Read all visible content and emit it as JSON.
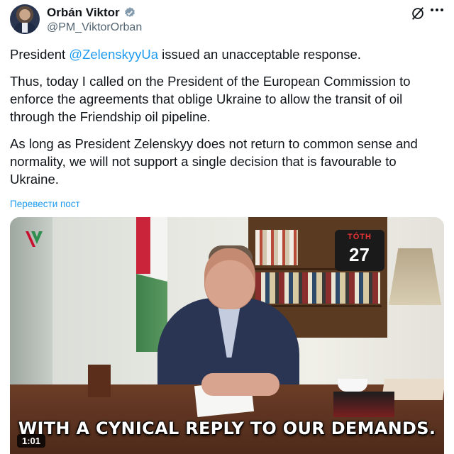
{
  "author": {
    "display_name": "Orbán Viktor",
    "handle": "@PM_ViktorOrban"
  },
  "post": {
    "p1_before": "President ",
    "p1_mention": "@ZelenskyyUa",
    "p1_after": " issued an unacceptable response.",
    "p2": "Thus, today I called on the President of the European Commission to enforce the agreements that oblige Ukraine to allow the transit of oil through the Friendship oil pipeline.",
    "p3": "As long as President Zelenskyy does not return to common sense and normality, we will not support a single decision that is favourable to Ukraine.",
    "translate_label": "Перевести пост"
  },
  "media": {
    "caption": "WITH A CYNICAL REPLY TO OUR DEMANDS.",
    "duration": "1:01",
    "jersey_name": "TÓTH",
    "jersey_number": "27"
  },
  "icons": {
    "verified": "verified-badge-icon",
    "grok": "grok-icon",
    "more": "more-options-icon"
  },
  "colors": {
    "accent": "#1d9bf0",
    "text": "#0f1419",
    "muted": "#536471"
  }
}
